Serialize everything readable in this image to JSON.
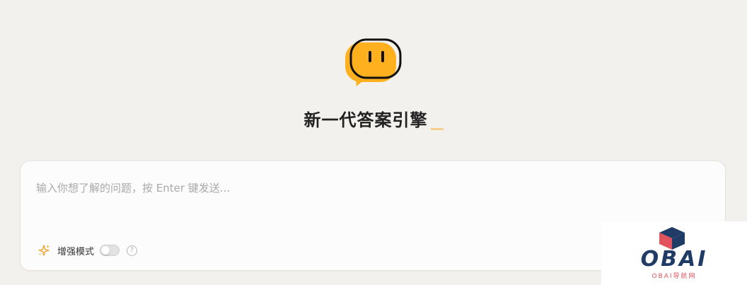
{
  "hero": {
    "headline": "新一代答案引擎",
    "colors": {
      "logo_fill": "#ffb01e",
      "logo_outline": "#111111",
      "cursor": "#f6cf8d"
    }
  },
  "chat": {
    "placeholder": "输入你想了解的问题，按 Enter 键发送...",
    "value": "",
    "enhanced_mode_label": "增强模式",
    "enhanced_mode_on": false,
    "help_glyph": "?",
    "icons": {
      "mode": "sparkle-icon",
      "help": "question-circle-icon"
    }
  },
  "watermark": {
    "text": "OBAI",
    "subtext": "OBAI导航网",
    "colors": {
      "text": "#1f3b66",
      "cube": "#e0525c"
    }
  }
}
